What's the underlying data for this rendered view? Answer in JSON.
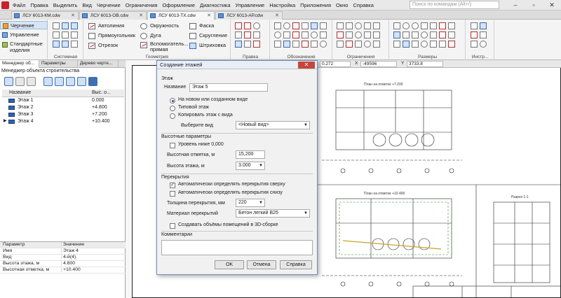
{
  "menu": [
    "Файл",
    "Правка",
    "Выделить",
    "Вид",
    "Черчение",
    "Ограничения",
    "Оформление",
    "Диагностика",
    "Управление",
    "Настройка",
    "Приложения",
    "Окно",
    "Справка"
  ],
  "search_placeholder": "Поиск по командам (Alt+/)",
  "doc_tabs": [
    "ЛСУ 6013-КМ.cdw",
    "ЛСУ 6013-ОВ.cdw",
    "ЛСУ 6013-ТХ.cdw",
    "ЛСУ 6013-АР.cdw"
  ],
  "modes": [
    "Черчение",
    "Управление",
    "Стандартные изделия"
  ],
  "ribbon": {
    "col1": [
      "Автолиния",
      "Прямоугольник",
      "Отрезок"
    ],
    "col2": [
      "Окружность",
      "Дуга",
      "Вспомогатель... прямая"
    ],
    "col3": [
      "Фаска",
      "Скругление",
      "Штриховка"
    ],
    "groups": [
      "Системная",
      "Геометрия",
      "Правка",
      "Обозначения",
      "Ограничения",
      "Размеры",
      "Инстр..."
    ]
  },
  "panel": {
    "tabs": [
      "Менеджер об...",
      "Параметры",
      "Дерево черте..."
    ],
    "title": "Менеджер объекта строительства",
    "col_name": "Название",
    "col_value": "Выс. о...",
    "floors": [
      {
        "name": "Этаж 1",
        "value": "0.000"
      },
      {
        "name": "Этаж 2",
        "value": "+4.800"
      },
      {
        "name": "Этаж 3",
        "value": "+7.200"
      },
      {
        "name": "Этаж 4",
        "value": "+10.400"
      }
    ],
    "props_head": {
      "key": "Параметр",
      "value": "Значение"
    },
    "props": [
      {
        "key": "Имя",
        "value": "Этаж 4"
      },
      {
        "key": "Вид",
        "value": "4-й(4)"
      },
      {
        "key": "Высота этажа, м",
        "value": "4.800"
      },
      {
        "key": "Высотная отметка, м",
        "value": "+10.400"
      }
    ]
  },
  "view_toolbar": {
    "scale": "0.272",
    "x_label": "X",
    "x_value": "-49596",
    "y_label": "Y",
    "y_value": "3733.8"
  },
  "dialog": {
    "title": "Создание этажей",
    "section_floor": "Этаж",
    "name_label": "Название",
    "name_value": "Этаж 5",
    "radio_new": "На новом или созданном виде",
    "radio_typical": "Типовой этаж",
    "radio_copy": "Копировать этаж с вида",
    "choose_view_label": "Выберите вид",
    "choose_view_value": "<Новый вид>",
    "section_height": "Высотные параметры",
    "below_zero": "Уровень ниже 0,000",
    "elev_label": "Высотная отметка, м",
    "elev_value": "15,200",
    "floor_h_label": "Высота этажа, м",
    "floor_h_value": "3.000",
    "section_slabs": "Перекрытия",
    "auto_top": "Автоматически определять перекрытия сверху",
    "auto_bottom": "Автоматически определять перекрытия снизу",
    "thick_label": "Толщина перекрытия, мм",
    "thick_value": "220",
    "material_label": "Материал перекрытий",
    "material_value": "Бетон легкий В25",
    "create_rooms": "Создавать объёмы помещений в 3D-сборке",
    "comments_label": "Комментарии",
    "ok": "OK",
    "cancel": "Отмена",
    "help": "Справка"
  },
  "drawing": {
    "plan1_title": "План на отметке +7.200",
    "plan2_title": "План на отметке +10.400",
    "plan3_title": "Разрез 1-1"
  }
}
